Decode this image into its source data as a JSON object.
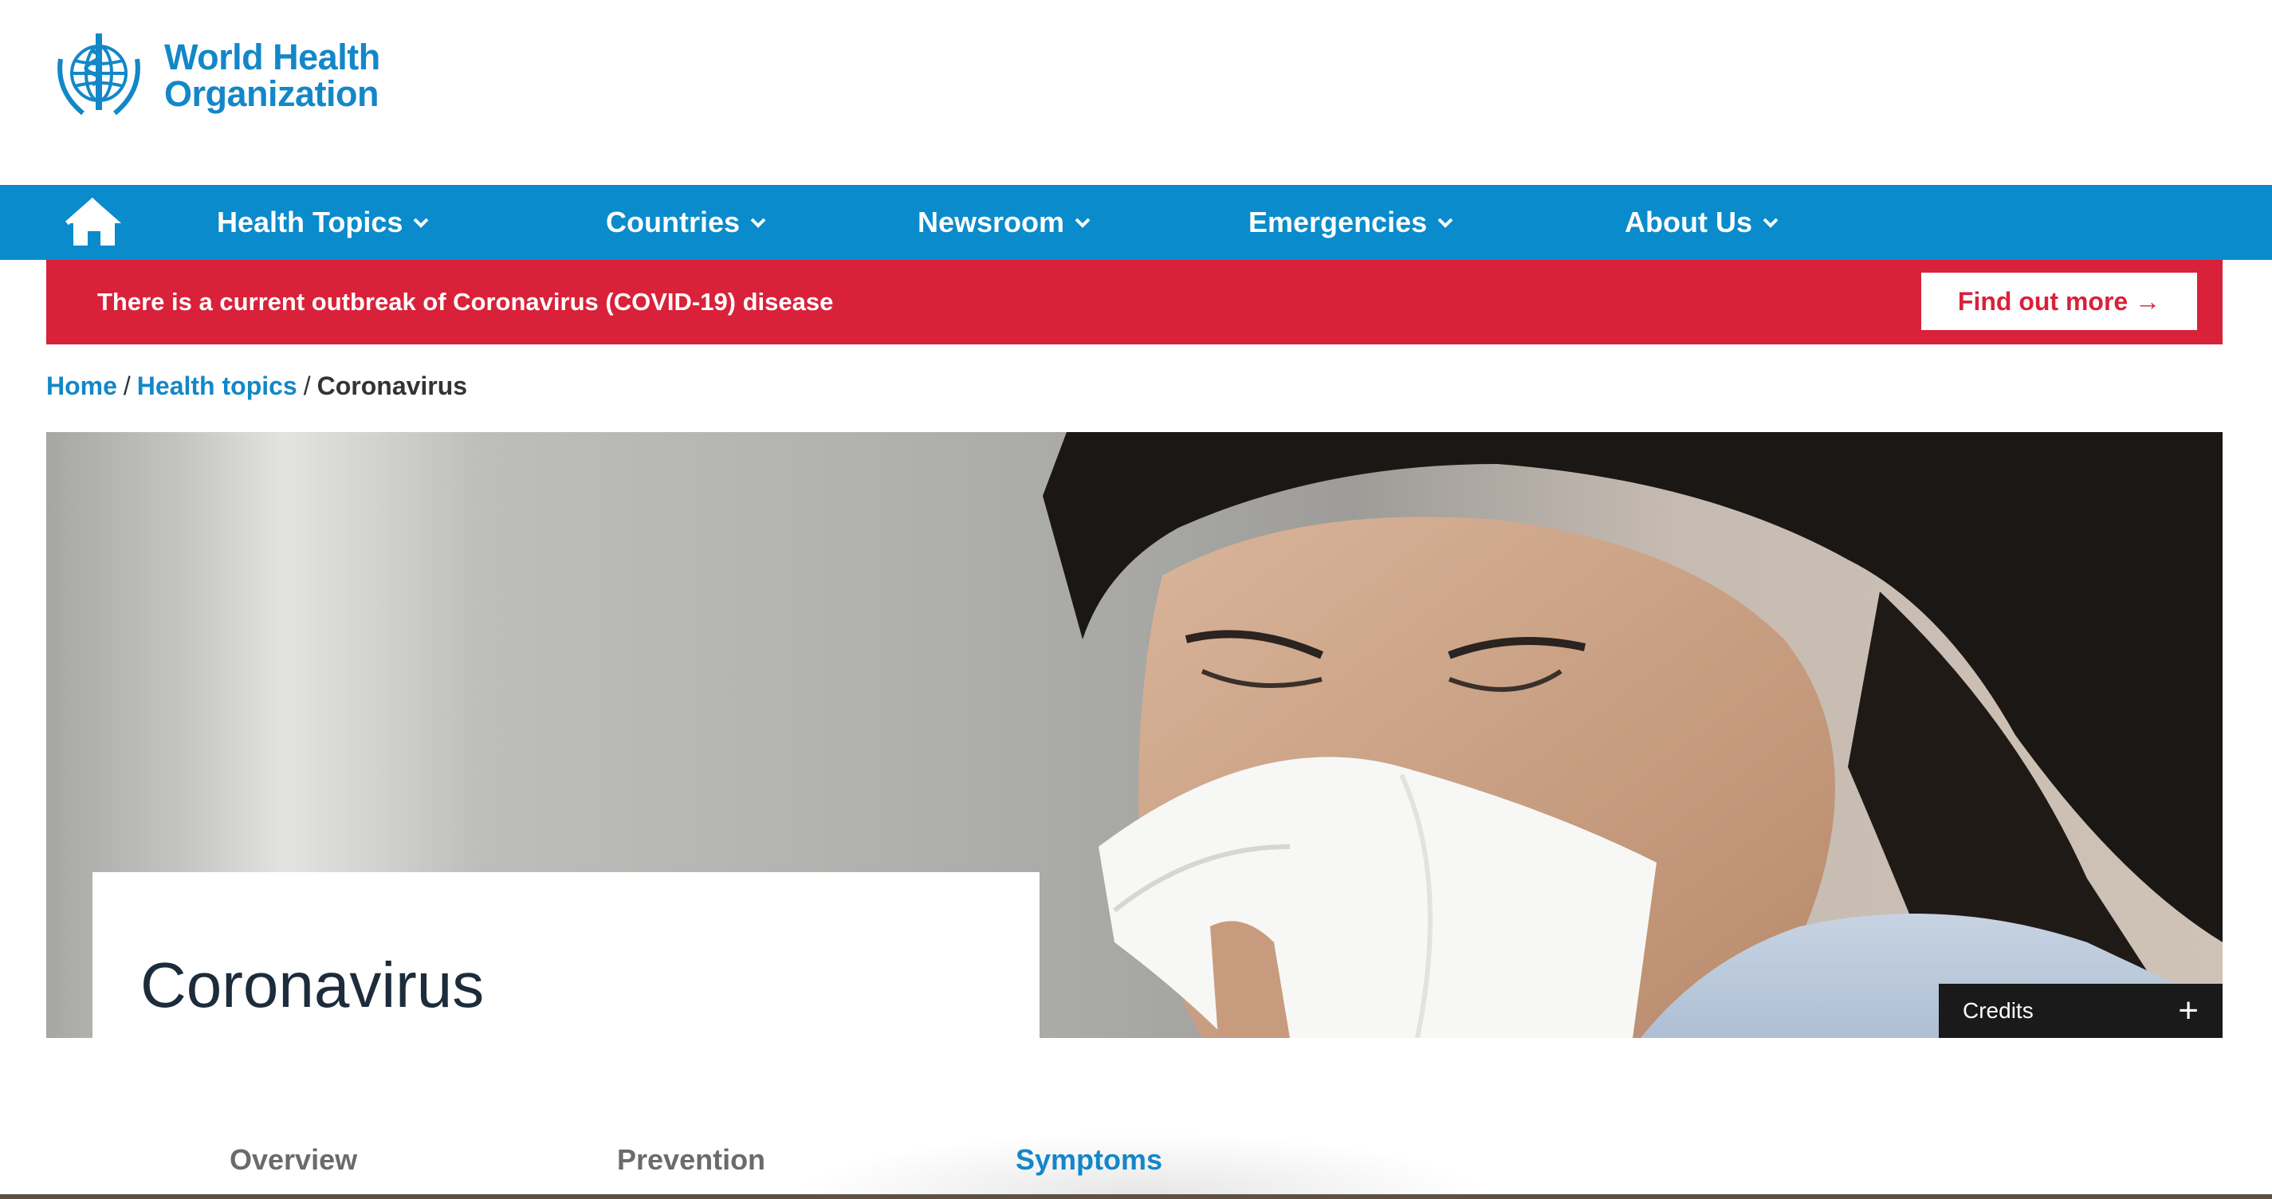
{
  "header": {
    "logo_line1": "World Health",
    "logo_line2": "Organization"
  },
  "nav": {
    "home_icon": "home-icon",
    "items": [
      {
        "label": "Health Topics"
      },
      {
        "label": "Countries"
      },
      {
        "label": "Newsroom"
      },
      {
        "label": "Emergencies"
      },
      {
        "label": "About Us"
      }
    ]
  },
  "alert": {
    "text": "There is a current outbreak of Coronavirus (COVID-19) disease",
    "button_label": "Find out more →"
  },
  "breadcrumb": {
    "home": "Home",
    "sep": "/",
    "health_topics": "Health topics",
    "current": "Coronavirus"
  },
  "hero": {
    "title": "Coronavirus",
    "credits_label": "Credits",
    "credits_icon": "+"
  },
  "tabs": [
    {
      "label": "Overview",
      "active": false
    },
    {
      "label": "Prevention",
      "active": false
    },
    {
      "label": "Symptoms",
      "active": true
    }
  ],
  "colors": {
    "brand_blue": "#0a8bcb",
    "link_blue": "#1387c8",
    "alert_red": "#d92139"
  }
}
